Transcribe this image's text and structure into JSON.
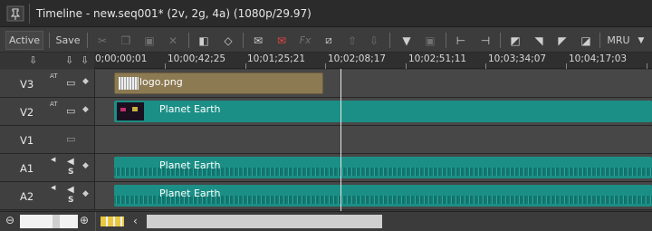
{
  "window": {
    "title": "Timeline - new.seq001* (2v, 2g, 4a) (1080p/29.97)"
  },
  "toolbar": {
    "active_label": "Active",
    "save_label": "Save",
    "fx_label": "Fx",
    "mru_label": "MRU"
  },
  "ruler": {
    "ticks": [
      "0;00;00;01",
      "10;00;42;25",
      "10;01;25;21",
      "10;02;08;17",
      "10;02;51;11",
      "10;03;34;07",
      "10;04;17;03"
    ]
  },
  "tracks": [
    {
      "name": "V3",
      "sub": "AT",
      "type": "video"
    },
    {
      "name": "V2",
      "sub": "AT",
      "type": "video"
    },
    {
      "name": "V1",
      "sub": "",
      "type": "video"
    },
    {
      "name": "A1",
      "sub": "",
      "type": "audio",
      "solo": "S"
    },
    {
      "name": "A2",
      "sub": "",
      "type": "audio",
      "solo": "S"
    }
  ],
  "clips": {
    "v3": {
      "label": "logo.png",
      "color": "#8c7a52"
    },
    "v2": {
      "label": "Planet Earth",
      "color": "#1b8f86"
    },
    "a1": {
      "label": "Planet Earth",
      "color": "#1b8f86"
    },
    "a2": {
      "label": "Planet Earth",
      "color": "#1b8f86"
    }
  },
  "icons": {
    "pin": "pin-icon",
    "zoom_out": "zoom-out-icon",
    "zoom_in": "zoom-in-icon",
    "scroll_left": "chevron-left-icon"
  }
}
